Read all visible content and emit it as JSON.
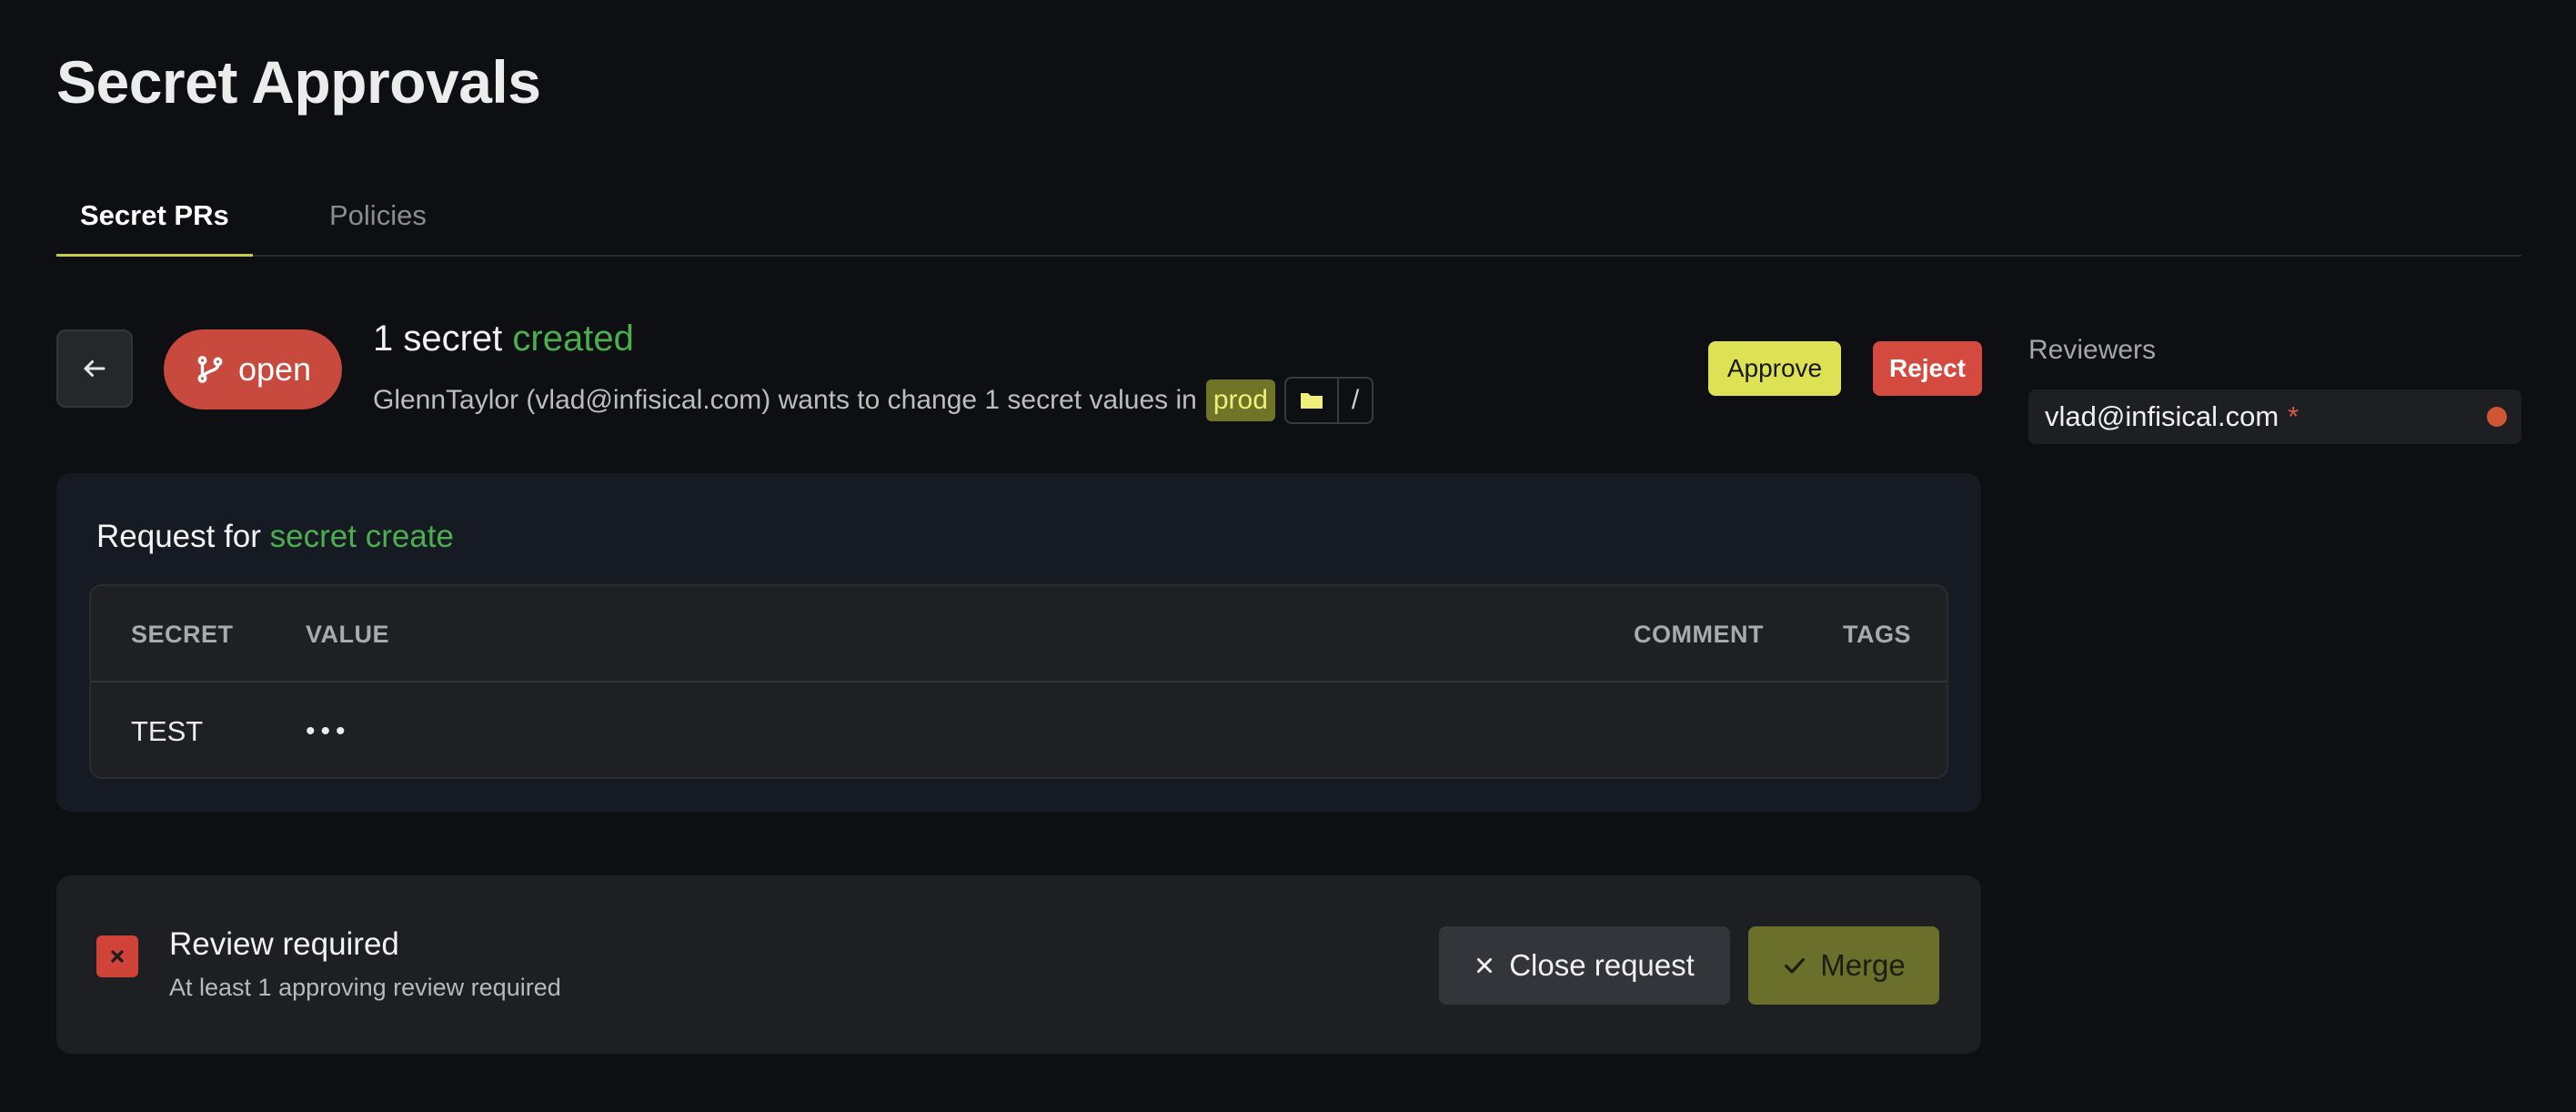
{
  "page": {
    "title": "Secret Approvals"
  },
  "tabs": [
    {
      "label": "Secret PRs",
      "active": true
    },
    {
      "label": "Policies",
      "active": false
    }
  ],
  "request": {
    "status": "open",
    "title_prefix": "1 secret ",
    "title_action": "created",
    "description": "GlennTaylor (vlad@infisical.com) wants to change 1 secret values in",
    "environment": "prod",
    "path": "/"
  },
  "actions": {
    "approve_label": "Approve",
    "reject_label": "Reject"
  },
  "reviewers": {
    "title": "Reviewers",
    "items": [
      {
        "email": "vlad@infisical.com",
        "required_mark": "*",
        "status_color": "#cf5534"
      }
    ]
  },
  "request_card": {
    "heading_prefix": "Request for ",
    "heading_action": "secret create",
    "columns": [
      "SECRET",
      "VALUE",
      "COMMENT",
      "TAGS"
    ],
    "rows": [
      {
        "secret": "TEST",
        "value": "•••",
        "comment": "",
        "tags": ""
      }
    ]
  },
  "review": {
    "title": "Review required",
    "subtitle": "At least 1 approving review required",
    "close_label": "Close request",
    "merge_label": "Merge"
  },
  "colors": {
    "accent_green": "#4cae4f",
    "approve_bg": "#dde254",
    "reject_bg": "#d54a3f",
    "status_open_bg": "#c84a3e",
    "merge_bg": "#6b6f2c",
    "env_badge_bg": "#6f7427"
  },
  "icons": {
    "back": "arrow-left-icon",
    "status": "git-branch-icon",
    "folder": "folder-icon",
    "review_state": "close-icon",
    "close_request": "close-icon",
    "merge": "check-icon"
  }
}
